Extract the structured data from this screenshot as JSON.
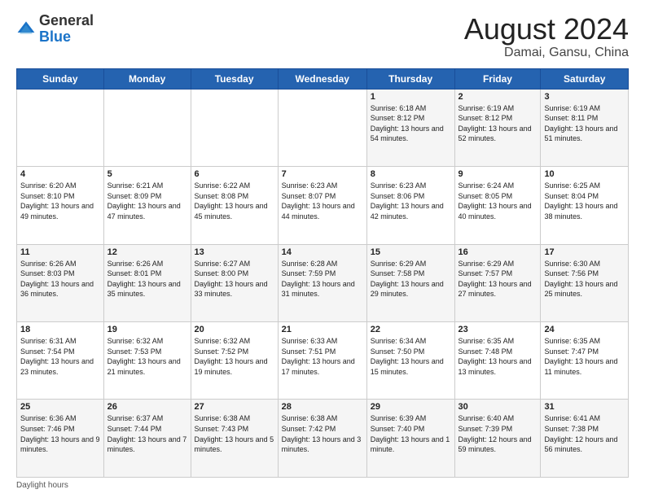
{
  "logo": {
    "general": "General",
    "blue": "Blue"
  },
  "title": "August 2024",
  "location": "Damai, Gansu, China",
  "days_of_week": [
    "Sunday",
    "Monday",
    "Tuesday",
    "Wednesday",
    "Thursday",
    "Friday",
    "Saturday"
  ],
  "footer": "Daylight hours",
  "weeks": [
    [
      {
        "day": "",
        "sunrise": "",
        "sunset": "",
        "daylight": ""
      },
      {
        "day": "",
        "sunrise": "",
        "sunset": "",
        "daylight": ""
      },
      {
        "day": "",
        "sunrise": "",
        "sunset": "",
        "daylight": ""
      },
      {
        "day": "",
        "sunrise": "",
        "sunset": "",
        "daylight": ""
      },
      {
        "day": "1",
        "sunrise": "6:18 AM",
        "sunset": "8:12 PM",
        "daylight": "13 hours and 54 minutes."
      },
      {
        "day": "2",
        "sunrise": "6:19 AM",
        "sunset": "8:12 PM",
        "daylight": "13 hours and 52 minutes."
      },
      {
        "day": "3",
        "sunrise": "6:19 AM",
        "sunset": "8:11 PM",
        "daylight": "13 hours and 51 minutes."
      }
    ],
    [
      {
        "day": "4",
        "sunrise": "6:20 AM",
        "sunset": "8:10 PM",
        "daylight": "13 hours and 49 minutes."
      },
      {
        "day": "5",
        "sunrise": "6:21 AM",
        "sunset": "8:09 PM",
        "daylight": "13 hours and 47 minutes."
      },
      {
        "day": "6",
        "sunrise": "6:22 AM",
        "sunset": "8:08 PM",
        "daylight": "13 hours and 45 minutes."
      },
      {
        "day": "7",
        "sunrise": "6:23 AM",
        "sunset": "8:07 PM",
        "daylight": "13 hours and 44 minutes."
      },
      {
        "day": "8",
        "sunrise": "6:23 AM",
        "sunset": "8:06 PM",
        "daylight": "13 hours and 42 minutes."
      },
      {
        "day": "9",
        "sunrise": "6:24 AM",
        "sunset": "8:05 PM",
        "daylight": "13 hours and 40 minutes."
      },
      {
        "day": "10",
        "sunrise": "6:25 AM",
        "sunset": "8:04 PM",
        "daylight": "13 hours and 38 minutes."
      }
    ],
    [
      {
        "day": "11",
        "sunrise": "6:26 AM",
        "sunset": "8:03 PM",
        "daylight": "13 hours and 36 minutes."
      },
      {
        "day": "12",
        "sunrise": "6:26 AM",
        "sunset": "8:01 PM",
        "daylight": "13 hours and 35 minutes."
      },
      {
        "day": "13",
        "sunrise": "6:27 AM",
        "sunset": "8:00 PM",
        "daylight": "13 hours and 33 minutes."
      },
      {
        "day": "14",
        "sunrise": "6:28 AM",
        "sunset": "7:59 PM",
        "daylight": "13 hours and 31 minutes."
      },
      {
        "day": "15",
        "sunrise": "6:29 AM",
        "sunset": "7:58 PM",
        "daylight": "13 hours and 29 minutes."
      },
      {
        "day": "16",
        "sunrise": "6:29 AM",
        "sunset": "7:57 PM",
        "daylight": "13 hours and 27 minutes."
      },
      {
        "day": "17",
        "sunrise": "6:30 AM",
        "sunset": "7:56 PM",
        "daylight": "13 hours and 25 minutes."
      }
    ],
    [
      {
        "day": "18",
        "sunrise": "6:31 AM",
        "sunset": "7:54 PM",
        "daylight": "13 hours and 23 minutes."
      },
      {
        "day": "19",
        "sunrise": "6:32 AM",
        "sunset": "7:53 PM",
        "daylight": "13 hours and 21 minutes."
      },
      {
        "day": "20",
        "sunrise": "6:32 AM",
        "sunset": "7:52 PM",
        "daylight": "13 hours and 19 minutes."
      },
      {
        "day": "21",
        "sunrise": "6:33 AM",
        "sunset": "7:51 PM",
        "daylight": "13 hours and 17 minutes."
      },
      {
        "day": "22",
        "sunrise": "6:34 AM",
        "sunset": "7:50 PM",
        "daylight": "13 hours and 15 minutes."
      },
      {
        "day": "23",
        "sunrise": "6:35 AM",
        "sunset": "7:48 PM",
        "daylight": "13 hours and 13 minutes."
      },
      {
        "day": "24",
        "sunrise": "6:35 AM",
        "sunset": "7:47 PM",
        "daylight": "13 hours and 11 minutes."
      }
    ],
    [
      {
        "day": "25",
        "sunrise": "6:36 AM",
        "sunset": "7:46 PM",
        "daylight": "13 hours and 9 minutes."
      },
      {
        "day": "26",
        "sunrise": "6:37 AM",
        "sunset": "7:44 PM",
        "daylight": "13 hours and 7 minutes."
      },
      {
        "day": "27",
        "sunrise": "6:38 AM",
        "sunset": "7:43 PM",
        "daylight": "13 hours and 5 minutes."
      },
      {
        "day": "28",
        "sunrise": "6:38 AM",
        "sunset": "7:42 PM",
        "daylight": "13 hours and 3 minutes."
      },
      {
        "day": "29",
        "sunrise": "6:39 AM",
        "sunset": "7:40 PM",
        "daylight": "13 hours and 1 minute."
      },
      {
        "day": "30",
        "sunrise": "6:40 AM",
        "sunset": "7:39 PM",
        "daylight": "12 hours and 59 minutes."
      },
      {
        "day": "31",
        "sunrise": "6:41 AM",
        "sunset": "7:38 PM",
        "daylight": "12 hours and 56 minutes."
      }
    ]
  ]
}
